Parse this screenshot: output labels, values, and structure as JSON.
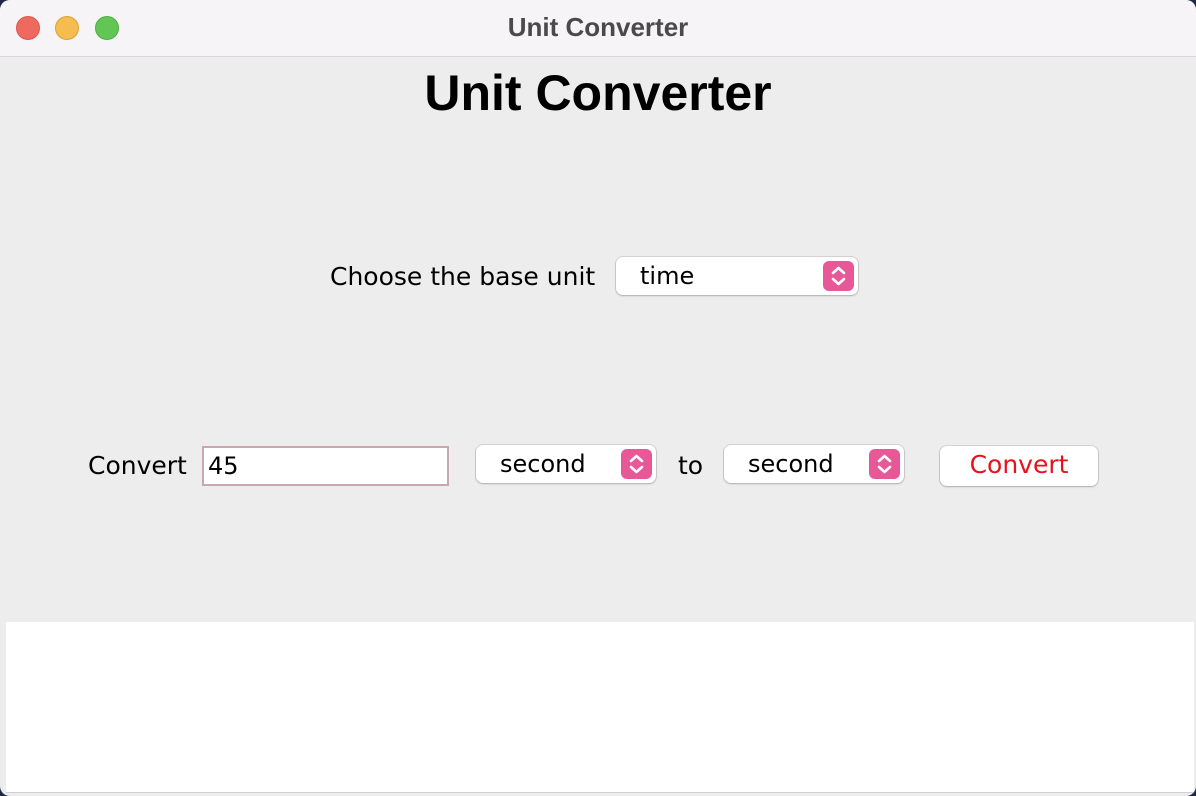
{
  "window": {
    "title": "Unit Converter"
  },
  "main": {
    "heading": "Unit Converter",
    "base_unit_label": "Choose the base unit",
    "base_unit_selected": "time",
    "convert_label": "Convert",
    "input_value": "45",
    "from_unit_selected": "second",
    "to_label": "to",
    "to_unit_selected": "second",
    "convert_button_label": "Convert"
  },
  "output": {
    "text": ""
  },
  "colors": {
    "chevron_accent": "#e85797",
    "button_text": "#e8121a"
  }
}
